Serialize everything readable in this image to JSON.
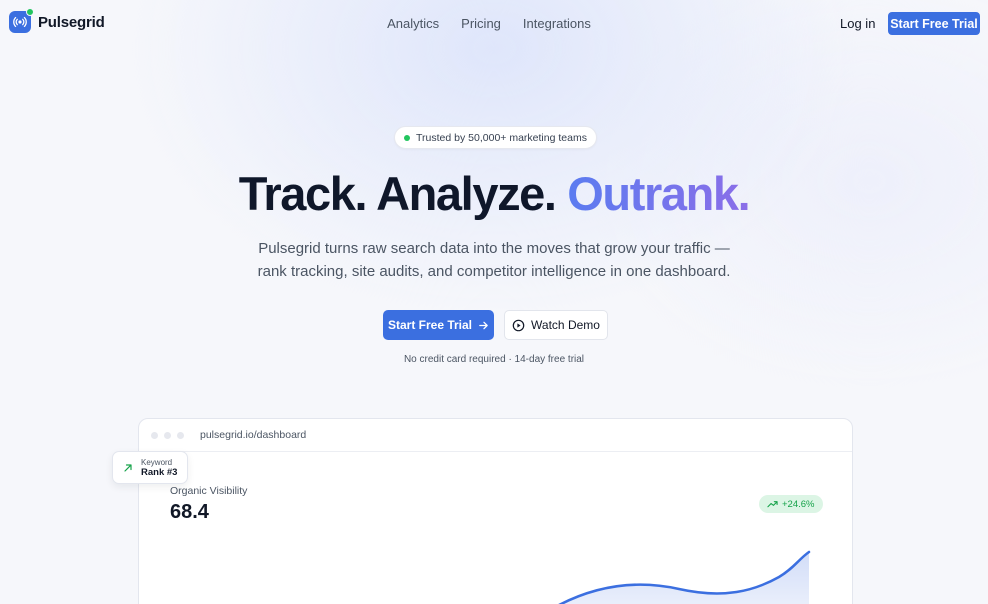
{
  "brand": {
    "name": "Pulsegrid"
  },
  "nav": {
    "links": [
      "Analytics",
      "Pricing",
      "Integrations"
    ],
    "login": "Log in",
    "cta": "Start Free Trial"
  },
  "hero": {
    "badge": "Trusted by 50,000+ marketing teams",
    "headline_main": "Track. Analyze. ",
    "headline_accent": "Outrank.",
    "subtext_line1": "Pulsegrid turns raw search data into the moves that grow your traffic —",
    "subtext_line2": "rank tracking, site audits, and competitor intelligence in one dashboard.",
    "primary_cta": "Start Free Trial",
    "secondary_cta": "Watch Demo",
    "fineprint": "No credit card required · 14-day free trial"
  },
  "dashboard": {
    "url": "pulsegrid.io/dashboard",
    "metric_label": "Organic Visibility",
    "metric_value": "68.4",
    "delta": "+24.6%",
    "float_card_label": "Keyword",
    "float_card_value": "Rank #3"
  },
  "colors": {
    "primary": "#3b6fe0",
    "accent_start": "#5b7cf0",
    "accent_end": "#8b6ee8",
    "success": "#22c55e"
  },
  "icons": {
    "logo": "signal-broadcast-icon",
    "arrow": "arrow-right-icon",
    "play": "play-circle-icon",
    "trend": "trending-up-icon"
  }
}
